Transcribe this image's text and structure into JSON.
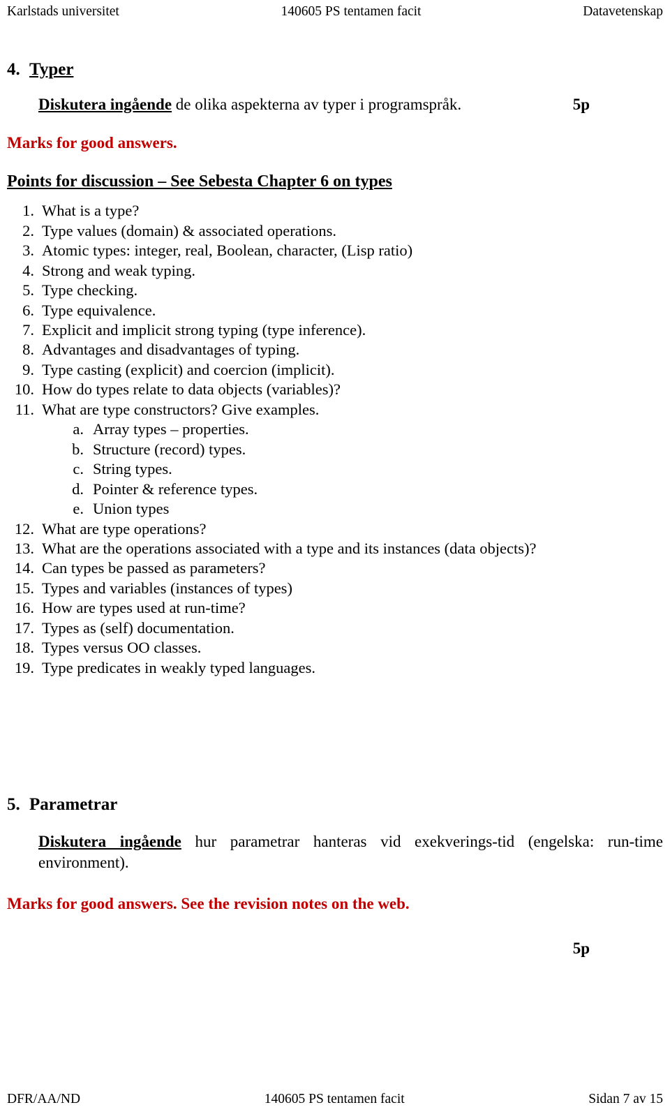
{
  "header": {
    "left": "Karlstads universitet",
    "center": "140605 PS tentamen facit",
    "right": "Datavetenskap"
  },
  "footer": {
    "left": "DFR/AA/ND",
    "center": "140605 PS tentamen facit",
    "right": "Sidan 7 av 15"
  },
  "colors": {
    "text": "#000000",
    "annotation_red": "#C00000",
    "page_background": "#ffffff"
  },
  "sections": [
    {
      "number": "4.",
      "title": "Typer",
      "prompt_bold": "Diskutera ingående",
      "prompt_rest": " de olika aspekterna av typer i programspråk.",
      "points": "5p",
      "marks_note": "Marks for good answers.",
      "points_lead": "Points for discussion – See Sebesta Chapter 6 on types",
      "items": [
        {
          "marker": "1.",
          "text": "What is a type?"
        },
        {
          "marker": "2.",
          "text": "Type values (domain) & associated operations."
        },
        {
          "marker": "3.",
          "text": "Atomic types: integer, real, Boolean, character, (Lisp ratio)"
        },
        {
          "marker": "4.",
          "text": "Strong and weak typing."
        },
        {
          "marker": "5.",
          "text": "Type checking."
        },
        {
          "marker": "6.",
          "text": "Type equivalence."
        },
        {
          "marker": "7.",
          "text": "Explicit and implicit strong typing (type inference)."
        },
        {
          "marker": "8.",
          "text": "Advantages and disadvantages of typing."
        },
        {
          "marker": "9.",
          "text": "Type casting (explicit) and coercion (implicit)."
        },
        {
          "marker": "10.",
          "text": "How do types relate to data objects (variables)?"
        },
        {
          "marker": "11.",
          "text": "What are type constructors? Give examples."
        },
        {
          "marker": "12.",
          "text": "What are type operations?"
        },
        {
          "marker": "13.",
          "text": "What are the operations associated with a type and its instances (data objects)?"
        },
        {
          "marker": "14.",
          "text": "Can types be passed as parameters?"
        },
        {
          "marker": "15.",
          "text": "Types and variables (instances of types)"
        },
        {
          "marker": "16.",
          "text": "How are types used at run-time?"
        },
        {
          "marker": "17.",
          "text": "Types as (self) documentation."
        },
        {
          "marker": "18.",
          "text": "Types versus OO classes."
        },
        {
          "marker": "19.",
          "text": "Type predicates in weakly typed languages."
        }
      ],
      "subitems": [
        {
          "marker": "a.",
          "text": "Array types – properties."
        },
        {
          "marker": "b.",
          "text": "Structure (record) types."
        },
        {
          "marker": "c.",
          "text": "String types."
        },
        {
          "marker": "d.",
          "text": "Pointer & reference types."
        },
        {
          "marker": "e.",
          "text": "Union types"
        }
      ]
    },
    {
      "number": "5.",
      "title": "Parametrar",
      "prompt_bold": "Diskutera ingående",
      "prompt_rest": " hur parametrar hanteras vid exekverings-tid (engelska: run-time environment).",
      "marks_note": "Marks for good answers. See the revision notes on the web.",
      "points": "5p"
    }
  ]
}
